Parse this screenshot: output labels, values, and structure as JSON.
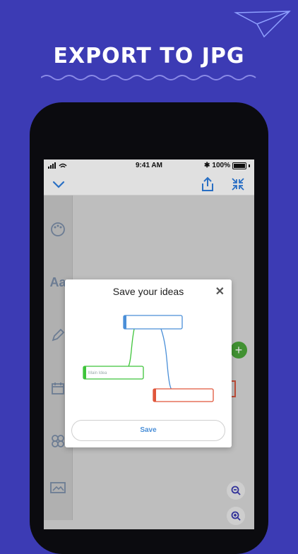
{
  "headline": "EXPORT TO JPG",
  "status": {
    "time": "9:41 AM",
    "battery": "100%"
  },
  "toolbar": {
    "collapse_icon": "chevron-down-icon",
    "share_icon": "share-icon",
    "fullscreen_icon": "compress-icon"
  },
  "side_rail": [
    "palette-icon",
    "text-style-icon",
    "pencil-icon",
    "calendar-icon",
    "cluster-icon",
    "image-icon"
  ],
  "side_rail_text_glyph": "Aa",
  "modal": {
    "title": "Save your ideas",
    "close": "✕",
    "node_label": "Main Idea",
    "save_label": "Save"
  },
  "colors": {
    "background": "#3c3bb4",
    "node_blue": "#4a8fd8",
    "node_green": "#3ec43a",
    "node_red": "#e0563b",
    "fab_green": "#4aa63a"
  }
}
